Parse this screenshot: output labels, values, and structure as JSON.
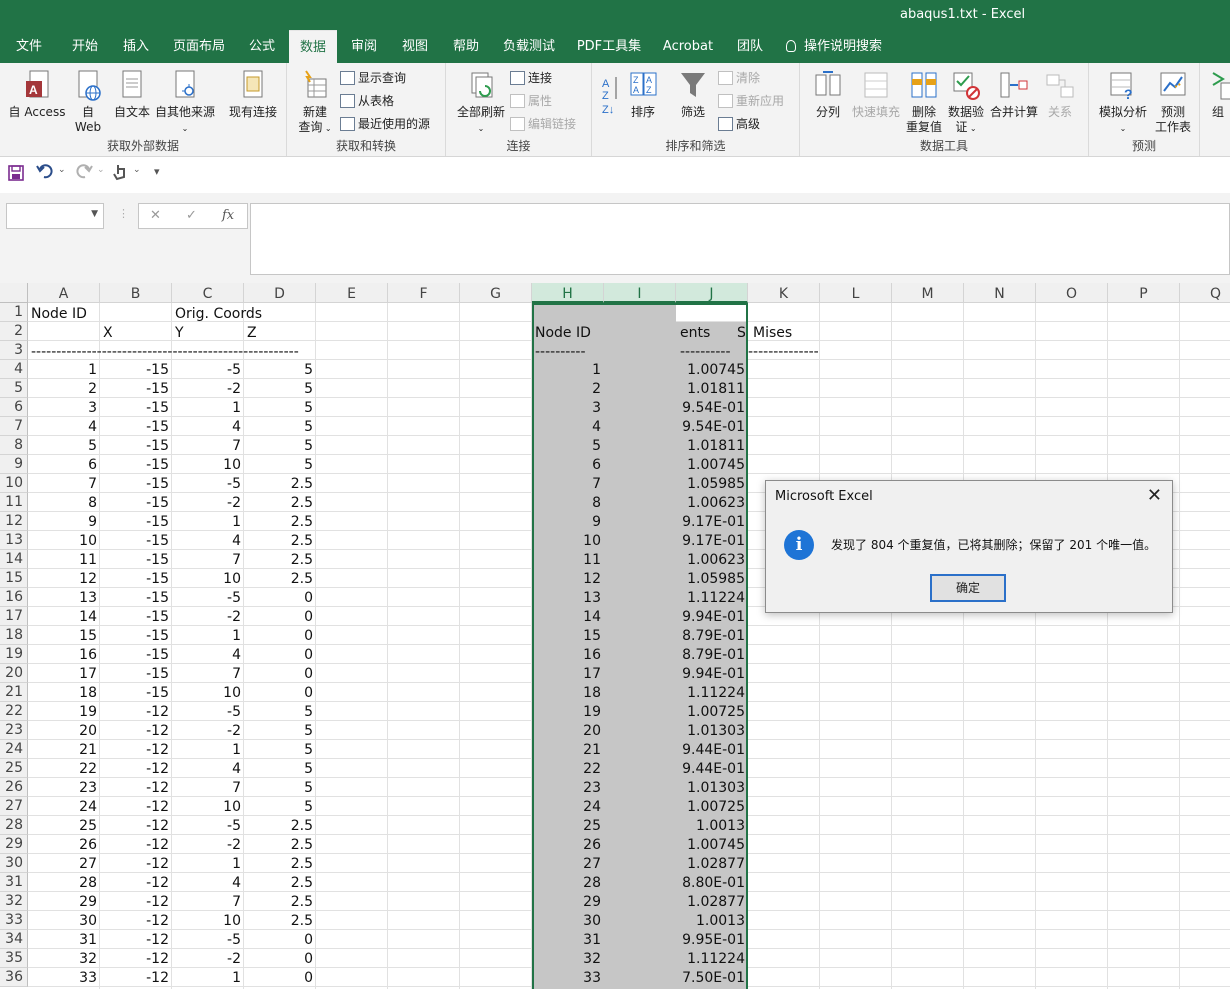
{
  "window": {
    "title": "abaqus1.txt  -  Excel"
  },
  "tabs": [
    "文件",
    "开始",
    "插入",
    "页面布局",
    "公式",
    "数据",
    "审阅",
    "视图",
    "帮助",
    "负载测试",
    "PDF工具集",
    "Acrobat",
    "团队",
    "操作说明搜索"
  ],
  "active_tab": "数据",
  "ribbon": {
    "get_external": {
      "label": "获取外部数据",
      "btn_access": "自 Access",
      "btn_web_1": "自",
      "btn_web_2": "Web",
      "btn_text": "自文本",
      "btn_other": "自其他来源",
      "btn_existing": "现有连接"
    },
    "get_transform": {
      "label": "获取和转换",
      "btn_new_query_1": "新建",
      "btn_new_query_2": "查询",
      "show_queries": "显示查询",
      "from_table": "从表格",
      "recent_sources": "最近使用的源"
    },
    "connections": {
      "label": "连接",
      "refresh_all": "全部刷新",
      "connections": "连接",
      "properties": "属性",
      "edit_links": "编辑链接"
    },
    "sort_filter": {
      "label": "排序和筛选",
      "sort": "排序",
      "filter": "筛选",
      "clear": "清除",
      "reapply": "重新应用",
      "advanced": "高级"
    },
    "data_tools": {
      "label": "数据工具",
      "split": "分列",
      "flash_fill": "快速填充",
      "remove_dup_1": "删除",
      "remove_dup_2": "重复值",
      "validation_1": "数据验",
      "validation_2": "证",
      "consolidate": "合并计算",
      "relationships": "关系"
    },
    "forecast": {
      "label": "预测",
      "whatif": "模拟分析",
      "sheet_1": "预测",
      "sheet_2": "工作表"
    },
    "group": {
      "label": "组"
    }
  },
  "formula_bar": {
    "name_box": "",
    "fx": "fx",
    "content": ""
  },
  "columns": [
    "A",
    "B",
    "C",
    "D",
    "E",
    "F",
    "G",
    "H",
    "I",
    "J",
    "K",
    "L",
    "M",
    "N",
    "O",
    "P",
    "Q"
  ],
  "header_cells": {
    "a1": "Node ID",
    "c1": "Orig. Coords",
    "b2": "X",
    "c2": "Y",
    "d2": "Z",
    "h2": "Node ID",
    "j2": "ents",
    "j2s": "S",
    "k2": "Mises",
    "dash_left": "-----------------------------------------------------",
    "dash_h": "----------",
    "dash_j": "----------",
    "dash_k": "--------------"
  },
  "rows": [
    {
      "r": "4",
      "a": "1",
      "b": "-15",
      "c": "-5",
      "d": "5",
      "h": "1",
      "j": "1.00745"
    },
    {
      "r": "5",
      "a": "2",
      "b": "-15",
      "c": "-2",
      "d": "5",
      "h": "2",
      "j": "1.01811"
    },
    {
      "r": "6",
      "a": "3",
      "b": "-15",
      "c": "1",
      "d": "5",
      "h": "3",
      "j": "9.54E-01"
    },
    {
      "r": "7",
      "a": "4",
      "b": "-15",
      "c": "4",
      "d": "5",
      "h": "4",
      "j": "9.54E-01"
    },
    {
      "r": "8",
      "a": "5",
      "b": "-15",
      "c": "7",
      "d": "5",
      "h": "5",
      "j": "1.01811"
    },
    {
      "r": "9",
      "a": "6",
      "b": "-15",
      "c": "10",
      "d": "5",
      "h": "6",
      "j": "1.00745"
    },
    {
      "r": "10",
      "a": "7",
      "b": "-15",
      "c": "-5",
      "d": "2.5",
      "h": "7",
      "j": "1.05985"
    },
    {
      "r": "11",
      "a": "8",
      "b": "-15",
      "c": "-2",
      "d": "2.5",
      "h": "8",
      "j": "1.00623"
    },
    {
      "r": "12",
      "a": "9",
      "b": "-15",
      "c": "1",
      "d": "2.5",
      "h": "9",
      "j": "9.17E-01"
    },
    {
      "r": "13",
      "a": "10",
      "b": "-15",
      "c": "4",
      "d": "2.5",
      "h": "10",
      "j": "9.17E-01"
    },
    {
      "r": "14",
      "a": "11",
      "b": "-15",
      "c": "7",
      "d": "2.5",
      "h": "11",
      "j": "1.00623"
    },
    {
      "r": "15",
      "a": "12",
      "b": "-15",
      "c": "10",
      "d": "2.5",
      "h": "12",
      "j": "1.05985"
    },
    {
      "r": "16",
      "a": "13",
      "b": "-15",
      "c": "-5",
      "d": "0",
      "h": "13",
      "j": "1.11224"
    },
    {
      "r": "17",
      "a": "14",
      "b": "-15",
      "c": "-2",
      "d": "0",
      "h": "14",
      "j": "9.94E-01"
    },
    {
      "r": "18",
      "a": "15",
      "b": "-15",
      "c": "1",
      "d": "0",
      "h": "15",
      "j": "8.79E-01"
    },
    {
      "r": "19",
      "a": "16",
      "b": "-15",
      "c": "4",
      "d": "0",
      "h": "16",
      "j": "8.79E-01"
    },
    {
      "r": "20",
      "a": "17",
      "b": "-15",
      "c": "7",
      "d": "0",
      "h": "17",
      "j": "9.94E-01"
    },
    {
      "r": "21",
      "a": "18",
      "b": "-15",
      "c": "10",
      "d": "0",
      "h": "18",
      "j": "1.11224"
    },
    {
      "r": "22",
      "a": "19",
      "b": "-12",
      "c": "-5",
      "d": "5",
      "h": "19",
      "j": "1.00725"
    },
    {
      "r": "23",
      "a": "20",
      "b": "-12",
      "c": "-2",
      "d": "5",
      "h": "20",
      "j": "1.01303"
    },
    {
      "r": "24",
      "a": "21",
      "b": "-12",
      "c": "1",
      "d": "5",
      "h": "21",
      "j": "9.44E-01"
    },
    {
      "r": "25",
      "a": "22",
      "b": "-12",
      "c": "4",
      "d": "5",
      "h": "22",
      "j": "9.44E-01"
    },
    {
      "r": "26",
      "a": "23",
      "b": "-12",
      "c": "7",
      "d": "5",
      "h": "23",
      "j": "1.01303"
    },
    {
      "r": "27",
      "a": "24",
      "b": "-12",
      "c": "10",
      "d": "5",
      "h": "24",
      "j": "1.00725"
    },
    {
      "r": "28",
      "a": "25",
      "b": "-12",
      "c": "-5",
      "d": "2.5",
      "h": "25",
      "j": "1.0013"
    },
    {
      "r": "29",
      "a": "26",
      "b": "-12",
      "c": "-2",
      "d": "2.5",
      "h": "26",
      "j": "1.00745"
    },
    {
      "r": "30",
      "a": "27",
      "b": "-12",
      "c": "1",
      "d": "2.5",
      "h": "27",
      "j": "1.02877"
    },
    {
      "r": "31",
      "a": "28",
      "b": "-12",
      "c": "4",
      "d": "2.5",
      "h": "28",
      "j": "8.80E-01"
    },
    {
      "r": "32",
      "a": "29",
      "b": "-12",
      "c": "7",
      "d": "2.5",
      "h": "29",
      "j": "1.02877"
    },
    {
      "r": "33",
      "a": "30",
      "b": "-12",
      "c": "10",
      "d": "2.5",
      "h": "30",
      "j": "1.0013"
    },
    {
      "r": "34",
      "a": "31",
      "b": "-12",
      "c": "-5",
      "d": "0",
      "h": "31",
      "j": "9.95E-01"
    },
    {
      "r": "35",
      "a": "32",
      "b": "-12",
      "c": "-2",
      "d": "0",
      "h": "32",
      "j": "1.11224"
    },
    {
      "r": "36",
      "a": "33",
      "b": "-12",
      "c": "1",
      "d": "0",
      "h": "33",
      "j": "7.50E-01"
    }
  ],
  "dialog": {
    "title": "Microsoft Excel",
    "icon": "info-icon",
    "message": "发现了 804 个重复值，已将其删除；保留了 201 个唯一值。",
    "ok": "确定"
  },
  "colors": {
    "accent": "#217346",
    "selection_shade": "#c6c6c6",
    "info_blue": "#1e74d6"
  }
}
